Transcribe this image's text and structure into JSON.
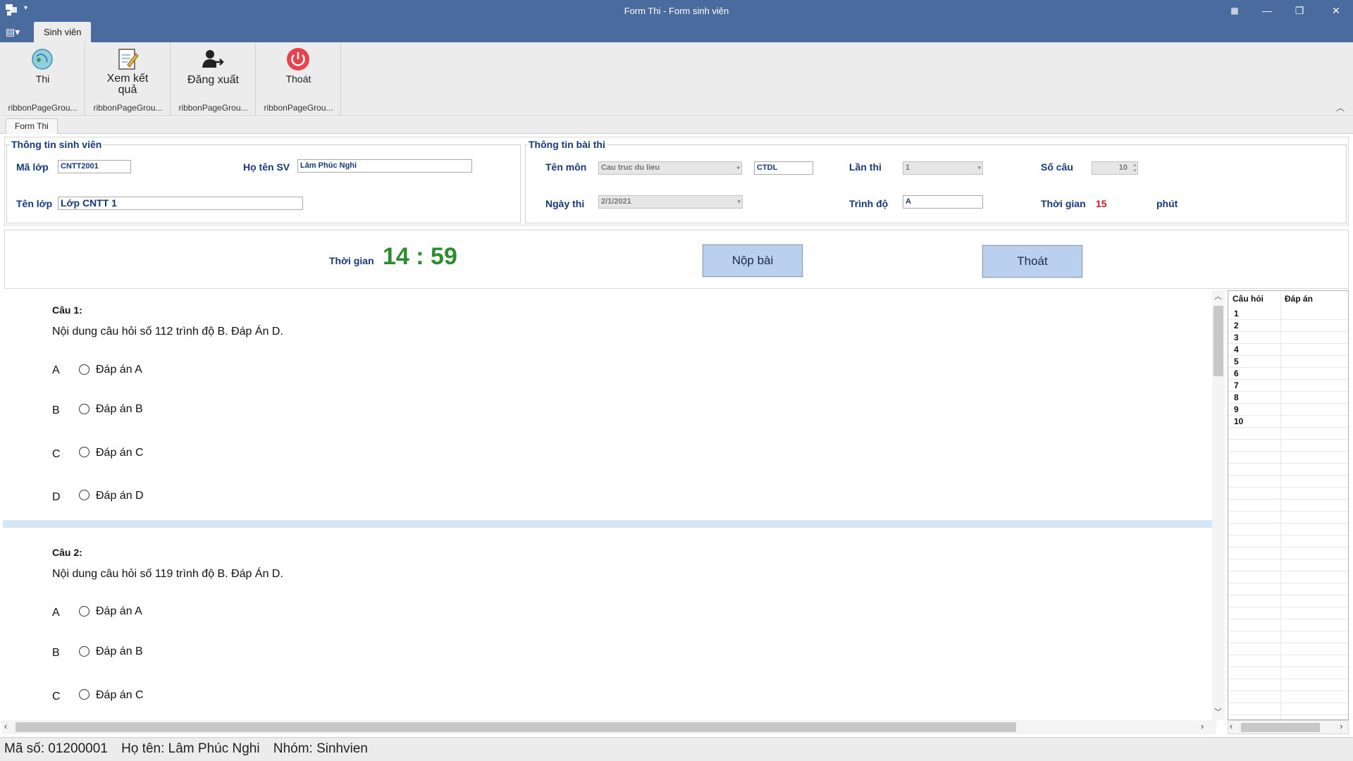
{
  "window": {
    "title": "Form Thi - Form sinh viên",
    "tab": "Sinh viên"
  },
  "ribbon": {
    "groups": [
      {
        "label": "Thi",
        "group_label": "ribbonPageGrou..."
      },
      {
        "label": "Xem kết quả",
        "group_label": "ribbonPageGrou..."
      },
      {
        "label": "Đăng xuất",
        "group_label": "ribbonPageGrou..."
      },
      {
        "label": "Thoát",
        "group_label": "ribbonPageGrou..."
      }
    ]
  },
  "doc_tab": "Form Thi",
  "student_info": {
    "title": "Thông tin sinh viên",
    "ma_lop_label": "Mã lớp",
    "ma_lop": "CNTT2001",
    "ho_ten_label": "Họ tên SV",
    "ho_ten": "Lâm Phúc Nghi",
    "ten_lop_label": "Tên lớp",
    "ten_lop": "Lớp CNTT 1"
  },
  "exam_info": {
    "title": "Thông tin bài thi",
    "ten_mon_label": "Tên môn",
    "ten_mon": "Cau truc du lieu",
    "ma_mon": "CTDL",
    "lan_thi_label": "Lần thi",
    "lan_thi": "1",
    "so_cau_label": "Số câu",
    "so_cau": "10",
    "ngay_thi_label": "Ngày thi",
    "ngay_thi": "2/1/2021",
    "trinh_do_label": "Trình độ",
    "trinh_do": "A",
    "thoi_gian_label": "Thời gian",
    "thoi_gian": "15",
    "thoi_gian_unit": "phút"
  },
  "timer": {
    "label": "Thời gian",
    "value": "14 : 59"
  },
  "buttons": {
    "submit": "Nộp bài",
    "exit": "Thoát"
  },
  "questions": [
    {
      "num": "Câu 1",
      "text": "Nội dung câu hỏi số 112 trình độ B. Đáp Án D.",
      "options": [
        {
          "letter": "A",
          "text": "Đáp án A"
        },
        {
          "letter": "B",
          "text": "Đáp án B"
        },
        {
          "letter": "C",
          "text": "Đáp án C"
        },
        {
          "letter": "D",
          "text": "Đáp án D"
        }
      ]
    },
    {
      "num": "Câu 2",
      "text": "Nội dung câu hỏi số 119 trình độ B. Đáp Án D.",
      "options": [
        {
          "letter": "A",
          "text": "Đáp án A"
        },
        {
          "letter": "B",
          "text": "Đáp án B"
        },
        {
          "letter": "C",
          "text": "Đáp án C"
        }
      ]
    }
  ],
  "answer_grid": {
    "headers": [
      "Câu hỏi",
      "Đáp án"
    ],
    "rows": [
      "1",
      "2",
      "3",
      "4",
      "5",
      "6",
      "7",
      "8",
      "9",
      "10"
    ]
  },
  "status": {
    "ma_so": "Mã số: 01200001",
    "ho_ten": "Họ tên: Lâm Phúc Nghi",
    "nhom": "Nhóm: Sinhvien"
  },
  "colors": {
    "titlebar": "#4a6b9d",
    "label_blue": "#16397a",
    "timer_green": "#2e8b2e",
    "time_red": "#c0172f",
    "button_blue": "#b9d0ee"
  }
}
